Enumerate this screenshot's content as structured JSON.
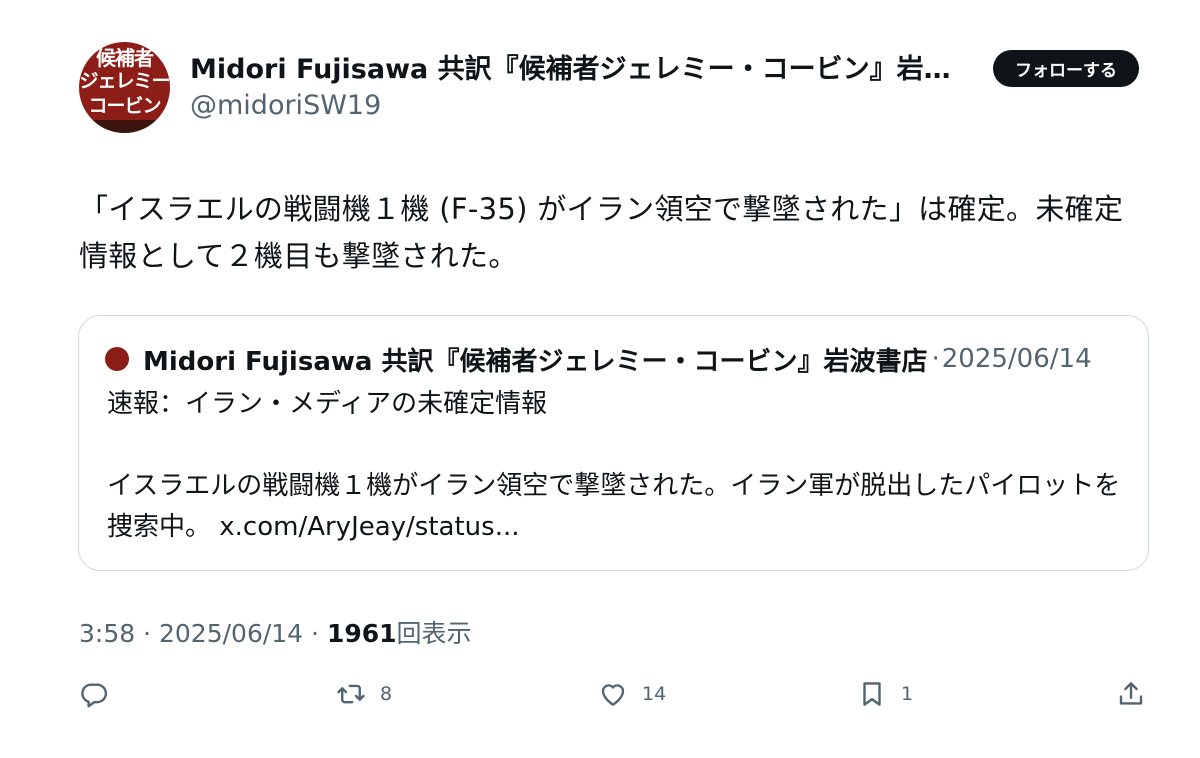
{
  "author": {
    "display_name": "Midori Fujisawa 共訳『候補者ジェレミー・コービン』岩波書店",
    "handle": "@midoriSW19",
    "avatar_lines": [
      "候補者",
      "ジェレミー",
      "コービン"
    ],
    "avatar_color": "#8c1d17"
  },
  "follow_button": {
    "label": "フォローする"
  },
  "tweet": {
    "text": "「イスラエルの戦闘機１機 (F-35) がイラン領空で撃墜された」は確定。未確定情報として２機目も撃墜された。"
  },
  "quote": {
    "author_name": "Midori Fujisawa 共訳『候補者ジェレミー・コービン』岩波書店",
    "separator": "·",
    "date": "2025/06/14",
    "text": "速報：イラン・メディアの未確定情報\n\nイスラエルの戦闘機１機がイラン領空で撃墜された。イラン軍が脱出したパイロットを捜索中。 x.com/AryJeay/status..."
  },
  "meta": {
    "time": "3:58",
    "separator": "·",
    "date": "2025/06/14",
    "views_count": "1961",
    "views_label": "回表示"
  },
  "actions": {
    "reply_icon": "reply-icon",
    "retweet_icon": "retweet-icon",
    "retweet_count": "8",
    "like_icon": "heart-icon",
    "like_count": "14",
    "bookmark_icon": "bookmark-icon",
    "bookmark_count": "1",
    "share_icon": "share-icon"
  },
  "colors": {
    "text_primary": "#0f1419",
    "text_secondary": "#536471",
    "border": "#cfd9de",
    "follow_bg": "#0f1419"
  }
}
